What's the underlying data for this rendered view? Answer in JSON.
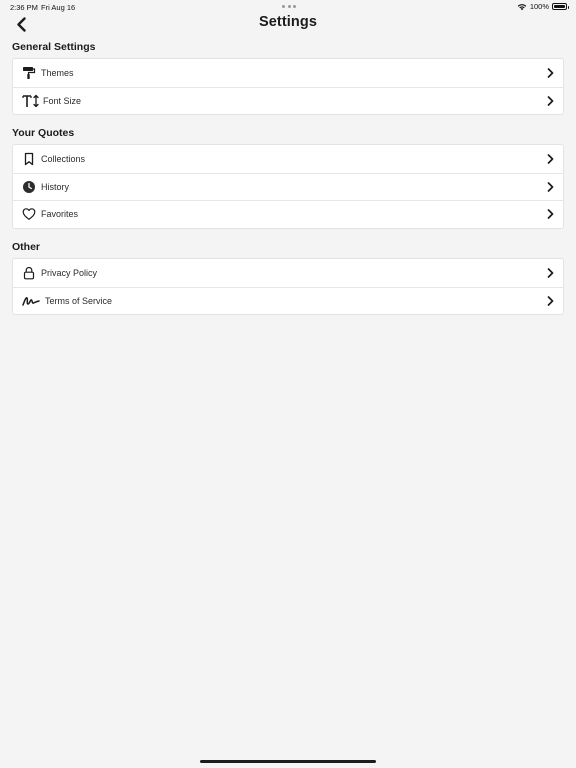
{
  "status_bar": {
    "time": "2:36 PM",
    "date": "Fri Aug 16",
    "battery_pct": "100%",
    "battery_level": 1.0,
    "wifi_icon": "wifi-icon"
  },
  "nav": {
    "back_icon": "chevron-left-icon",
    "title": "Settings"
  },
  "sections": [
    {
      "header": "General Settings",
      "items": [
        {
          "label": "Themes",
          "icon": "paint-roller-icon"
        },
        {
          "label": "Font Size",
          "icon": "text-size-icon"
        }
      ]
    },
    {
      "header": "Your Quotes",
      "items": [
        {
          "label": "Collections",
          "icon": "bookmark-icon"
        },
        {
          "label": "History",
          "icon": "clock-icon"
        },
        {
          "label": "Favorites",
          "icon": "heart-icon"
        }
      ]
    },
    {
      "header": "Other",
      "items": [
        {
          "label": "Privacy Policy",
          "icon": "lock-icon"
        },
        {
          "label": "Terms of Service",
          "icon": "signature-icon"
        }
      ]
    }
  ],
  "colors": {
    "background": "#f4f4f4",
    "card": "#ffffff",
    "text": "#1c1c1e",
    "chevron": "#1c1c1e"
  }
}
